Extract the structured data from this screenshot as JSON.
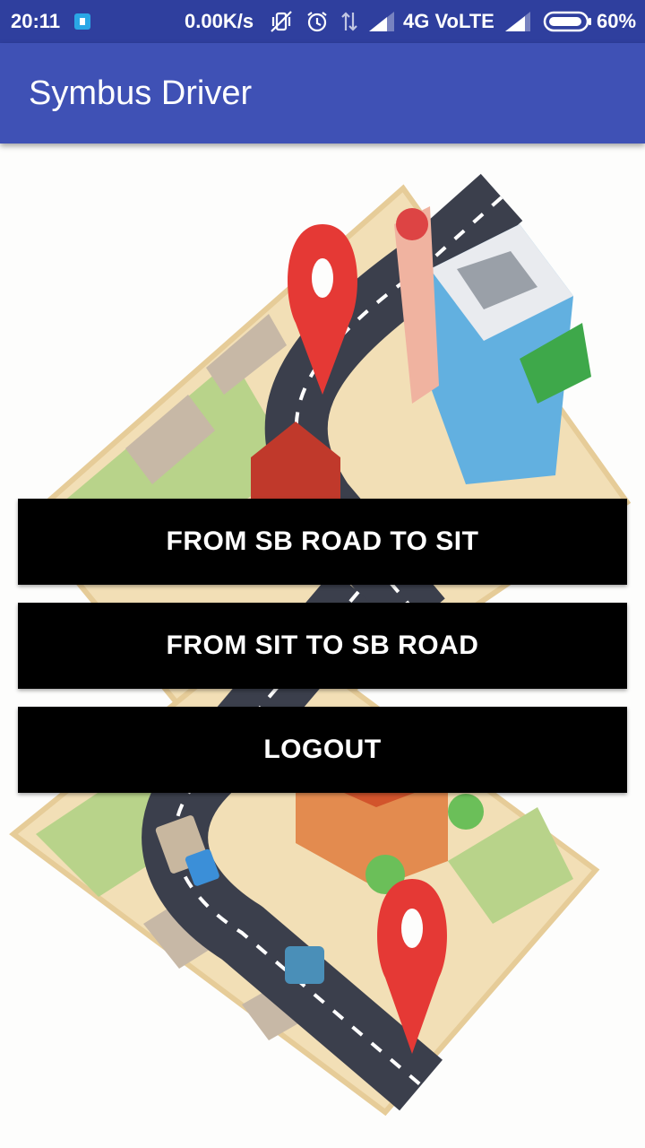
{
  "status_bar": {
    "time": "20:11",
    "net_speed": "0.00K/s",
    "network_type": "4G VoLTE",
    "battery": "60%",
    "icons": [
      "notification-icon",
      "vibrate-off-icon",
      "alarm-icon",
      "data-arrows-icon",
      "signal-icon",
      "battery-icon"
    ]
  },
  "app_bar": {
    "title": "Symbus Driver",
    "color": "#3f51b5"
  },
  "actions": {
    "sb_to_sit": "FROM SB ROAD TO SIT",
    "sit_to_sb": "FROM SIT TO SB ROAD",
    "logout": "LOGOUT"
  }
}
